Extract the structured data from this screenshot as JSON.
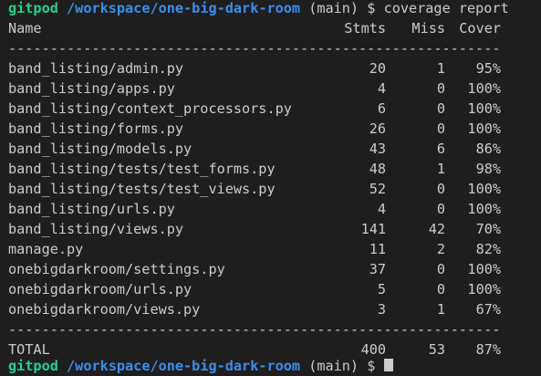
{
  "prompt": {
    "user": "gitpod",
    "path": "/workspace/one-big-dark-room",
    "branch": "(main)",
    "symbol": "$",
    "command": "coverage report"
  },
  "table": {
    "headers": {
      "name": "Name",
      "stmts": "Stmts",
      "miss": "Miss",
      "cover": "Cover"
    },
    "separator": "---------------------------------------------------------------------",
    "rows": [
      {
        "name": "band_listing/admin.py",
        "stmts": "20",
        "miss": "1",
        "cover": "95%"
      },
      {
        "name": "band_listing/apps.py",
        "stmts": "4",
        "miss": "0",
        "cover": "100%"
      },
      {
        "name": "band_listing/context_processors.py",
        "stmts": "6",
        "miss": "0",
        "cover": "100%"
      },
      {
        "name": "band_listing/forms.py",
        "stmts": "26",
        "miss": "0",
        "cover": "100%"
      },
      {
        "name": "band_listing/models.py",
        "stmts": "43",
        "miss": "6",
        "cover": "86%"
      },
      {
        "name": "band_listing/tests/test_forms.py",
        "stmts": "48",
        "miss": "1",
        "cover": "98%"
      },
      {
        "name": "band_listing/tests/test_views.py",
        "stmts": "52",
        "miss": "0",
        "cover": "100%"
      },
      {
        "name": "band_listing/urls.py",
        "stmts": "4",
        "miss": "0",
        "cover": "100%"
      },
      {
        "name": "band_listing/views.py",
        "stmts": "141",
        "miss": "42",
        "cover": "70%"
      },
      {
        "name": "manage.py",
        "stmts": "11",
        "miss": "2",
        "cover": "82%"
      },
      {
        "name": "onebigdarkroom/settings.py",
        "stmts": "37",
        "miss": "0",
        "cover": "100%"
      },
      {
        "name": "onebigdarkroom/urls.py",
        "stmts": "5",
        "miss": "0",
        "cover": "100%"
      },
      {
        "name": "onebigdarkroom/views.py",
        "stmts": "3",
        "miss": "1",
        "cover": "67%"
      }
    ],
    "total": {
      "name": "TOTAL",
      "stmts": "400",
      "miss": "53",
      "cover": "87%"
    }
  },
  "next_prompt": {
    "user": "gitpod",
    "path": "/workspace/one-big-dark-room",
    "branch": "(main)",
    "symbol": "$"
  }
}
